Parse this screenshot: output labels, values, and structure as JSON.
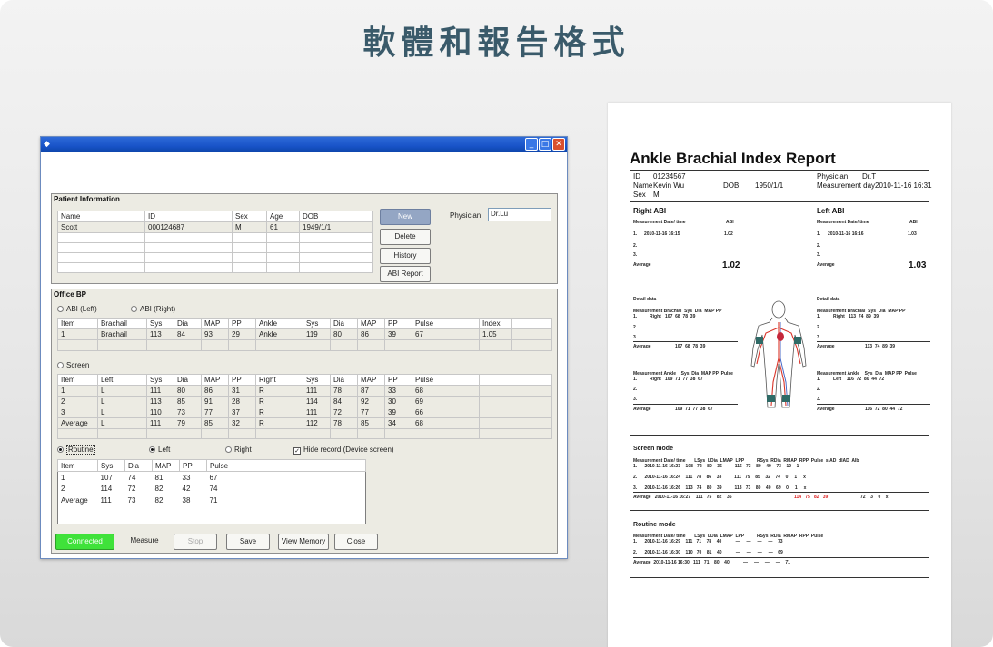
{
  "slide": {
    "title": "軟體和報告格式"
  },
  "window": {
    "buttons": {
      "minimize": "_",
      "maximize": "□",
      "close": "✕"
    }
  },
  "patient": {
    "title": "Patient Information",
    "headers": [
      "Name",
      "ID",
      "Sex",
      "Age",
      "DOB"
    ],
    "rows": [
      [
        "Scott",
        "000124687",
        "M",
        "61",
        "1949/1/1"
      ]
    ],
    "buttons": {
      "new": "New",
      "delete": "Delete",
      "history": "History",
      "abi_report": "ABI Report"
    },
    "physician_label": "Physician",
    "physician_value": "Dr.Lu"
  },
  "office": {
    "title": "Office BP",
    "radio_abi_left": "ABI (Left)",
    "radio_abi_right": "ABI (Right)",
    "abi_headers": [
      "Item",
      "Brachail",
      "Sys",
      "Dia",
      "MAP",
      "PP",
      "Ankle",
      "Sys",
      "Dia",
      "MAP",
      "PP",
      "Pulse",
      "Index"
    ],
    "abi_rows": [
      [
        "1",
        "Brachail",
        "113",
        "84",
        "93",
        "29",
        "Ankle",
        "119",
        "80",
        "86",
        "39",
        "67",
        "1.05"
      ]
    ],
    "radio_screen": "Screen",
    "screen_headers": [
      "Item",
      "Left",
      "Sys",
      "Dia",
      "MAP",
      "PP",
      "Right",
      "Sys",
      "Dia",
      "MAP",
      "PP",
      "Pulse"
    ],
    "screen_rows": [
      [
        "1",
        "L",
        "111",
        "80",
        "86",
        "31",
        "R",
        "111",
        "78",
        "87",
        "33",
        "68"
      ],
      [
        "2",
        "L",
        "113",
        "85",
        "91",
        "28",
        "R",
        "114",
        "84",
        "92",
        "30",
        "69"
      ],
      [
        "3",
        "L",
        "110",
        "73",
        "77",
        "37",
        "R",
        "111",
        "72",
        "77",
        "39",
        "66"
      ],
      [
        "Average",
        "L",
        "111",
        "79",
        "85",
        "32",
        "R",
        "112",
        "78",
        "85",
        "34",
        "68"
      ]
    ],
    "radio_routine": "Routine",
    "radio_left": "Left",
    "radio_right": "Right",
    "hide_record": "Hide record (Device screen)",
    "routine_headers": [
      "Item",
      "Sys",
      "Dia",
      "MAP",
      "PP",
      "Pulse"
    ],
    "routine_rows": [
      [
        "1",
        "107",
        "74",
        "81",
        "33",
        "67"
      ],
      [
        "2",
        "114",
        "72",
        "82",
        "42",
        "74"
      ],
      [
        "Average",
        "111",
        "73",
        "82",
        "38",
        "71"
      ]
    ]
  },
  "bottom": {
    "connected": "Connected",
    "measure": "Measure",
    "stop": "Stop",
    "save": "Save",
    "view_memory": "View Memory",
    "close": "Close"
  },
  "report": {
    "title": "Ankle Brachial Index Report",
    "id_label": "ID",
    "id_value": "01234567",
    "name_label": "Name",
    "name_value": "Kevin Wu",
    "dob_label": "DOB",
    "dob_value": "1950/1/1",
    "sex_label": "Sex",
    "sex_value": "M",
    "physician_label": "Physician",
    "physician_value": "Dr.T",
    "mday_label": "Measurement day",
    "mday_value": "2010-11-16 16:31",
    "right_abi": "Right ABI",
    "left_abi": "Left ABI",
    "md_label": "Measurement Date/ time",
    "abi_label": "ABI",
    "r1_time": "2010-11-16 16:15",
    "r1_val": "1.02",
    "l1_time": "2010-11-16 16:16",
    "l1_val": "1.03",
    "idx": [
      "1.",
      "2.",
      "3."
    ],
    "average": "Average",
    "r_avg": "1.02",
    "l_avg": "1.03",
    "detail": "Detail data",
    "dh_right": "Measurement Brachial  Sys  Dia  MAP PP",
    "dh_right_row": "1.          Right   107  68  78  39",
    "dh_avg_right": "107  68  78  39",
    "dh_left": "Measurement Brachial  Sys  Dia  MAP PP",
    "dh_left_row": "1.          Right   113  74  89  39",
    "dh_avg_left": "113  74  89  39",
    "ank_right": "Measurement Ankle    Sys  Dia  MAP PP  Pulse",
    "ank_right_row": "1.          Right   109  71  77  38  67",
    "ank_avg_right": "109  71  77  38  67",
    "ank_left": "Measurement Ankle    Sys  Dia  MAP PP  Pulse",
    "ank_left_row": "1.          Left    116  72  80  44  72",
    "ank_avg_left": "116  72  80  44  72",
    "screen_mode": "Screen mode",
    "sm_header": "Measurement Date/ time       LSys  LDia  LMAP  LPP          RSys  RDia  RMAP  RPP  Pulse  sIAD  dIAD  AIb",
    "sm_rows": [
      "1.      2010-11-16 16:23    108   72    80    36          116   73    80    49    73    10    1",
      "2.      2010-11-16 16:24    111   78    86    33          111   79    85    32    74    0     1     x",
      "3.      2010-11-16 16:26    113   74    80    39          113   73    80    40    69    0     1     x"
    ],
    "sm_avg_left": "Average   2010-11-16 16:27    111   75    82    36",
    "sm_avg_red": "114   75   82   39",
    "sm_avg_tail": "72    3    0    x",
    "routine_mode": "Routine mode",
    "rm_header": "Measurement Date/ time       LSys  LDia  LMAP  LPP          RSys  RDia  RMAP  RPP  Pulse",
    "rm_rows": [
      "1.      2010-11-16 16:29    111   71    78    40           —     —     —     —    73",
      "2.      2010-11-16 16:30    110   70    81    40           —     —     —     —    69",
      "Average  2010-11-16 16:30   111   71    80    40           —     —     —     —    71"
    ]
  }
}
